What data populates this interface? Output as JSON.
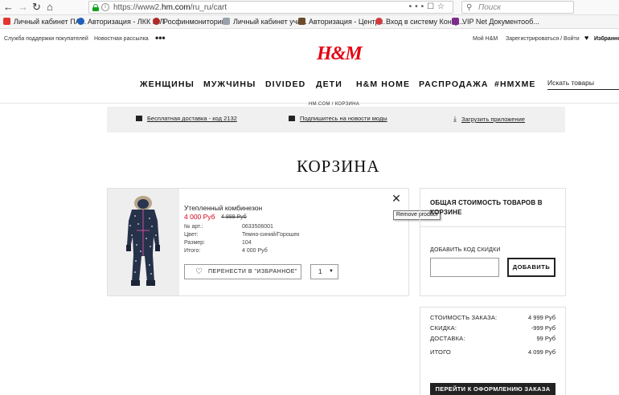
{
  "browser": {
    "url_prefix": "https://www2.",
    "url_domain": "hm.com",
    "url_path": "/ru_ru/cart",
    "search_placeholder": "Поиск",
    "bookmarks": [
      {
        "label": "Личный кабинет ПА...",
        "color": "#e3342f"
      },
      {
        "label": "Авторизация - ЛКК ЮЛ",
        "color": "#1f5fbf"
      },
      {
        "label": "Росфинмониторинг",
        "color": "#b02a2a"
      },
      {
        "label": "Личный кабинет уча...",
        "color": "#9aa3ad"
      },
      {
        "label": "Авторизация - Центр...",
        "color": "#6b4c2a"
      },
      {
        "label": "Вход в систему Конту...",
        "color": "#d13c3c"
      },
      {
        "label": "VIP Net Документооб...",
        "color": "#7a2c8c"
      }
    ]
  },
  "site": {
    "util_left": [
      "Служба поддержки покупателей",
      "Новостная рассылка"
    ],
    "more": "•••",
    "util_right": [
      "Мой H&M",
      "Зарегистрироваться / Войти",
      "Избранно"
    ],
    "logo": "H&M",
    "nav": [
      "ЖЕНЩИНЫ",
      "МУЖЧИНЫ",
      "DIVIDED",
      "ДЕТИ",
      "H&M HOME",
      "РАСПРОДАЖА",
      "#HMXME"
    ],
    "search_label": "Искать товары",
    "breadcrumb": [
      "HM.COM",
      "/",
      "КОРЗИНА"
    ],
    "promos": [
      "Бесплатная доставка - код 2132",
      "Подпишитесь на новости моды",
      "Загрузить приложение"
    ]
  },
  "cart": {
    "title": "КОРЗИНА",
    "item": {
      "name": "Утепленный комбинезон",
      "price": "4 000 Руб",
      "old_price": "4 999 Руб",
      "attributes": [
        {
          "label": "№ арт.:",
          "value": "0633506001"
        },
        {
          "label": "Цвет:",
          "value": "Темно-синий/Горошек"
        },
        {
          "label": "Размер:",
          "value": "104"
        },
        {
          "label": "Итого:",
          "value": "4 000 Руб"
        }
      ],
      "wishlist_label": "ПЕРЕНЕСТИ В \"ИЗБРАННОЕ\"",
      "quantity": "1"
    },
    "remove_tooltip": "Remove product"
  },
  "summary": {
    "title": "ОБЩАЯ СТОИМОСТЬ ТОВАРОВ В КОРЗИНЕ",
    "discount_label": "ДОБАВИТЬ КОД СКИДКИ",
    "discount_button": "ДОБАВИТЬ",
    "rows": [
      {
        "label": "СТОИМОСТЬ ЗАКАЗА:",
        "value": "4 999 Руб"
      },
      {
        "label": "СКИДКА:",
        "value": "-999 Руб"
      },
      {
        "label": "ДОСТАВКА:",
        "value": "99 Руб"
      },
      {
        "label": "ИТОГО",
        "value": "4 099 Руб"
      }
    ],
    "checkout": "ПЕРЕЙТИ К ОФОРМЛЕНИЮ ЗАКАЗА"
  },
  "colors": {
    "brand_red": "#e50010",
    "sale_red": "#d1001b",
    "secure_green": "#12a01c"
  }
}
